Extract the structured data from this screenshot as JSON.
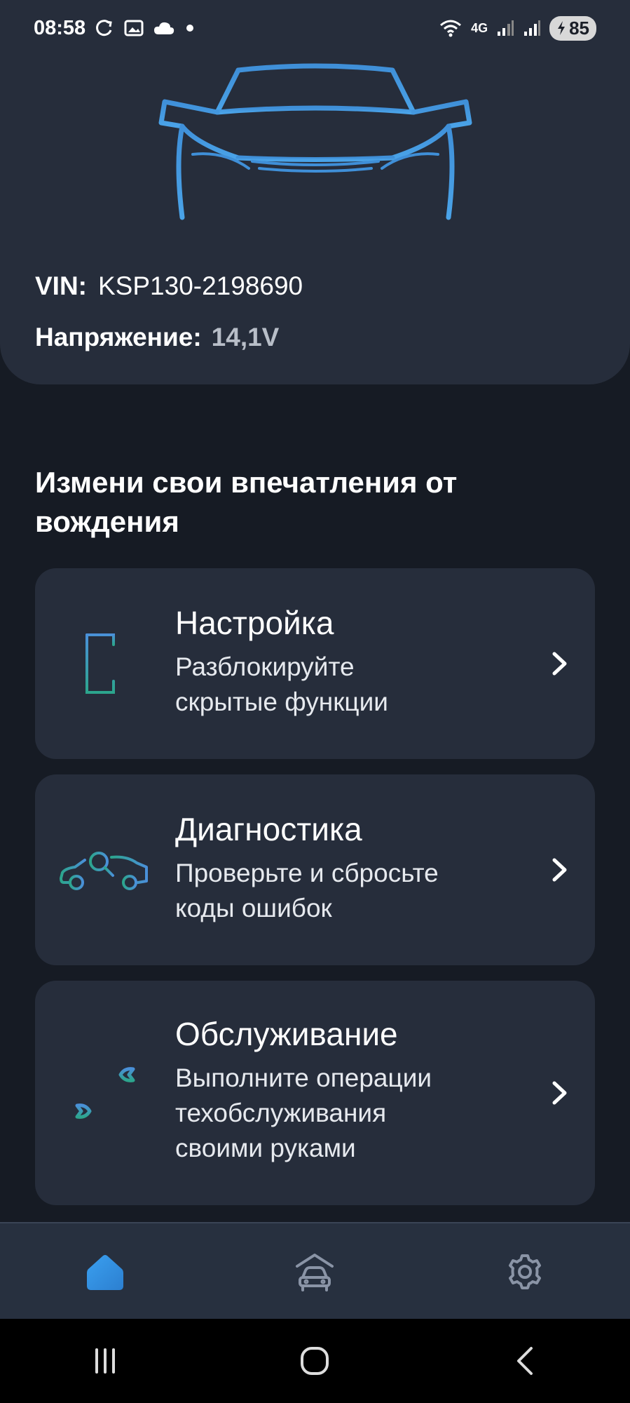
{
  "status_bar": {
    "time": "08:58",
    "battery": "85",
    "network": "4G",
    "icons": [
      "sync-icon",
      "gallery-icon",
      "cloud-icon",
      "dot-icon",
      "wifi-icon",
      "signal-icon",
      "signal-icon",
      "battery-charging-icon"
    ]
  },
  "vehicle": {
    "vin_label": "VIN:",
    "vin_value": "KSP130-2198690",
    "voltage_label": "Напряжение:",
    "voltage_value": "14,1V",
    "hero_icon": "car-front-outline-icon"
  },
  "section_title": "Измени свои впечатления от вождения",
  "features": [
    {
      "title": "Настройка",
      "subtitle": "Разблокируйте\nскрытые функции",
      "icon": "settings-document-icon"
    },
    {
      "title": "Диагностика",
      "subtitle": "Проверьте и сбросьте\nкоды ошибок",
      "icon": "car-search-icon"
    },
    {
      "title": "Обслуживание",
      "subtitle": "Выполните операции\nтехобслуживания\nсвоими руками",
      "icon": "wrench-tools-icon"
    }
  ],
  "bottom_nav": {
    "items": [
      {
        "name": "home",
        "icon": "home-icon",
        "active": true
      },
      {
        "name": "garage",
        "icon": "car-garage-icon",
        "active": false
      },
      {
        "name": "settings",
        "icon": "gear-icon",
        "active": false
      }
    ]
  },
  "colors": {
    "accent_blue": "#4a90d9",
    "accent_teal": "#2ca58d",
    "card_bg": "#262d3b",
    "page_bg": "#161b24"
  }
}
